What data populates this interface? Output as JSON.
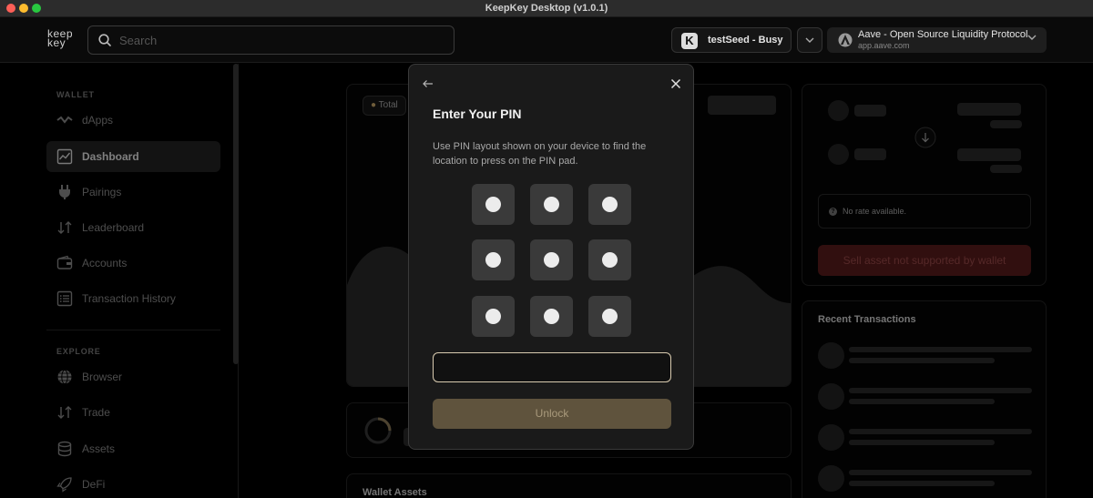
{
  "window": {
    "title": "KeepKey Desktop (v1.0.1)"
  },
  "header": {
    "logo_line1": "keep",
    "logo_line2": "key",
    "search_placeholder": "Search",
    "wallet_badge": "K",
    "wallet_label": "testSeed - Busy",
    "dapp_name": "Aave - Open Source Liquidity Protocol",
    "dapp_url": "app.aave.com"
  },
  "sidebar": {
    "wallet_section": "WALLET",
    "explore_section": "EXPLORE",
    "wallet_items": [
      {
        "label": "dApps",
        "icon": "dapps-icon"
      },
      {
        "label": "Dashboard",
        "icon": "chart-icon",
        "active": true
      },
      {
        "label": "Pairings",
        "icon": "plug-icon"
      },
      {
        "label": "Leaderboard",
        "icon": "arrows-updown-icon"
      },
      {
        "label": "Accounts",
        "icon": "wallet-icon"
      },
      {
        "label": "Transaction History",
        "icon": "list-icon"
      }
    ],
    "explore_items": [
      {
        "label": "Browser",
        "icon": "globe-icon"
      },
      {
        "label": "Trade",
        "icon": "arrows-updown-icon"
      },
      {
        "label": "Assets",
        "icon": "database-icon"
      },
      {
        "label": "DeFi",
        "icon": "rocket-icon"
      }
    ]
  },
  "main": {
    "total_chip": "Total",
    "wallet_assets_title": "Wallet Assets",
    "rate_text": "No rate available.",
    "sell_button": "Sell asset not supported by wallet",
    "recent_transactions_title": "Recent Transactions"
  },
  "modal": {
    "title": "Enter Your PIN",
    "description": "Use PIN layout shown on your device to find the location to press on the PIN pad.",
    "input_value": "",
    "unlock_label": "Unlock"
  },
  "colors": {
    "accent": "#5f533d",
    "input_border": "#d9cbb0",
    "sell_button": "#5a1c1c"
  }
}
